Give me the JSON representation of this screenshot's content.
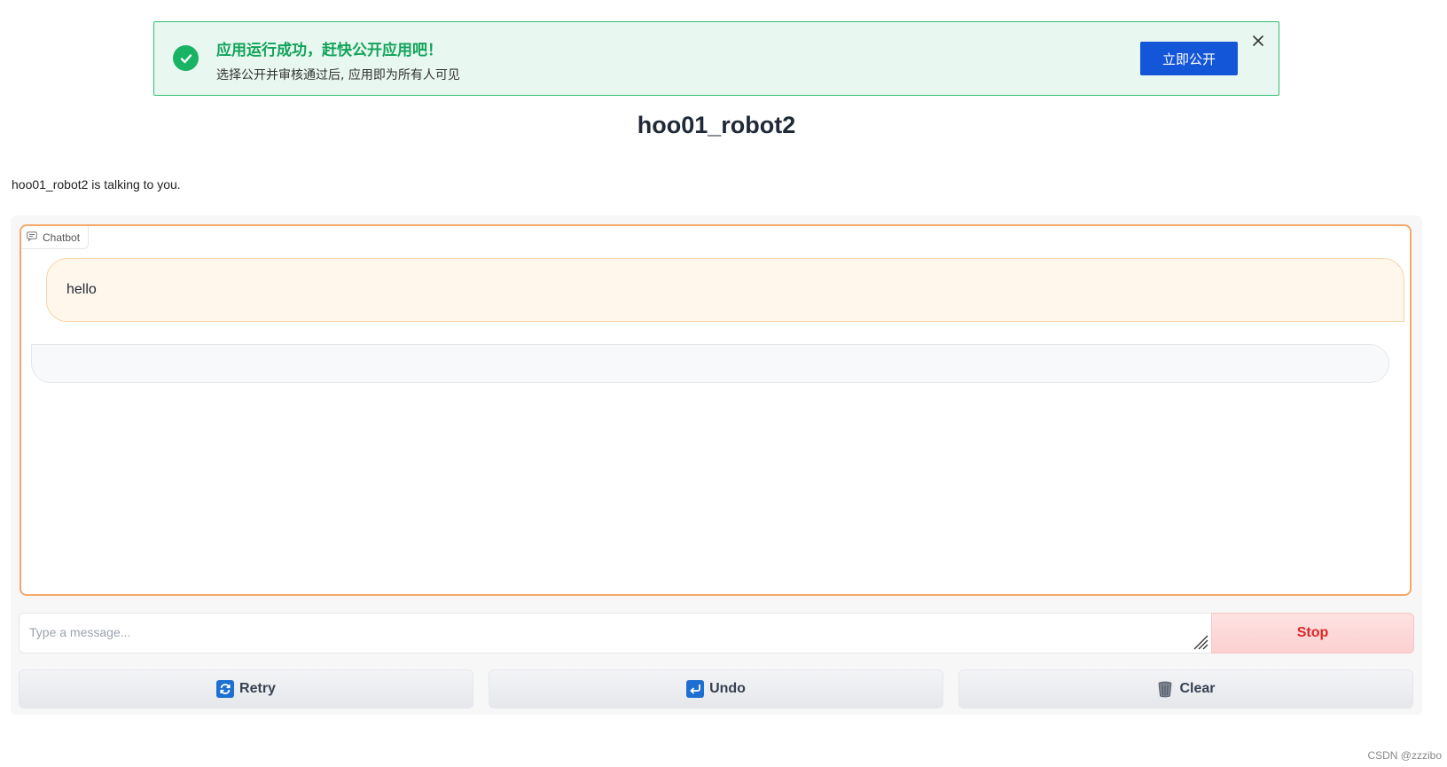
{
  "banner": {
    "title": "应用运行成功，赶快公开应用吧！",
    "subtitle": "选择公开并审核通过后, 应用即为所有人可见",
    "publish_label": "立即公开"
  },
  "app": {
    "title": "hoo01_robot2",
    "description": "hoo01_robot2 is talking to you."
  },
  "chatbot": {
    "label": "Chatbot",
    "messages": [
      {
        "role": "user",
        "text": "hello"
      },
      {
        "role": "bot",
        "text": ""
      }
    ]
  },
  "input": {
    "placeholder": "Type a message...",
    "value": ""
  },
  "buttons": {
    "stop_label": "Stop",
    "retry_label": "Retry",
    "undo_label": "Undo",
    "clear_label": "Clear"
  },
  "icons": {
    "retry": "retry-icon",
    "undo": "undo-icon",
    "clear": "trash-icon"
  },
  "colors": {
    "success_green": "#19b364",
    "publish_blue": "#1456d8",
    "chatbot_border": "#f5a86b",
    "stop_red": "#dc2626"
  },
  "watermark": "CSDN @zzzibo"
}
